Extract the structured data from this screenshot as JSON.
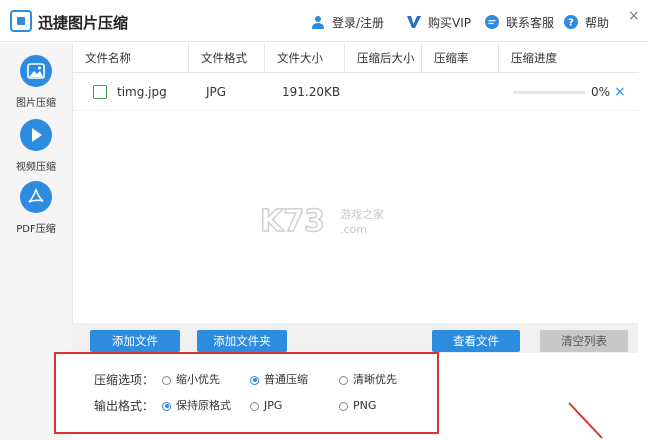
{
  "app": {
    "title": "迅捷图片压缩",
    "brand_color": "#2d8be0"
  },
  "toolbar": {
    "login_label": "登录/注册",
    "vip_label": "购买VIP",
    "service_label": "联系客服",
    "help_label": "帮助",
    "close_glyph": "×"
  },
  "sidebar": {
    "items": [
      {
        "label": "图片压缩",
        "icon": "image-icon"
      },
      {
        "label": "视频压缩",
        "icon": "play-icon"
      },
      {
        "label": "PDF压缩",
        "icon": "pdf-icon"
      }
    ]
  },
  "table": {
    "columns": [
      "文件名称",
      "文件格式",
      "文件大小",
      "压缩后大小",
      "压缩率",
      "压缩进度"
    ],
    "rows": [
      {
        "name": "timg.jpg",
        "format": "JPG",
        "size": "191.20KB",
        "compressed_size": "",
        "ratio": "",
        "progress_text": "0%",
        "progress_value": 0
      }
    ]
  },
  "watermark": {
    "text": "K73",
    "sub1": "游戏之家",
    "sub2": ".com"
  },
  "buttons": {
    "add_file": "添加文件",
    "add_folder": "添加文件夹",
    "view_file": "查看文件",
    "clear_list": "清空列表"
  },
  "options": {
    "compress_label": "压缩选项：",
    "compress_choices": [
      "缩小优先",
      "普通压缩",
      "清晰优先"
    ],
    "compress_selected": "普通压缩",
    "output_label": "输出格式：",
    "output_choices": [
      "保持原格式",
      "JPG",
      "PNG"
    ],
    "output_selected": "保持原格式"
  },
  "colors": {
    "highlight_box": "#e03131",
    "file_icon": "#3fa34d"
  }
}
